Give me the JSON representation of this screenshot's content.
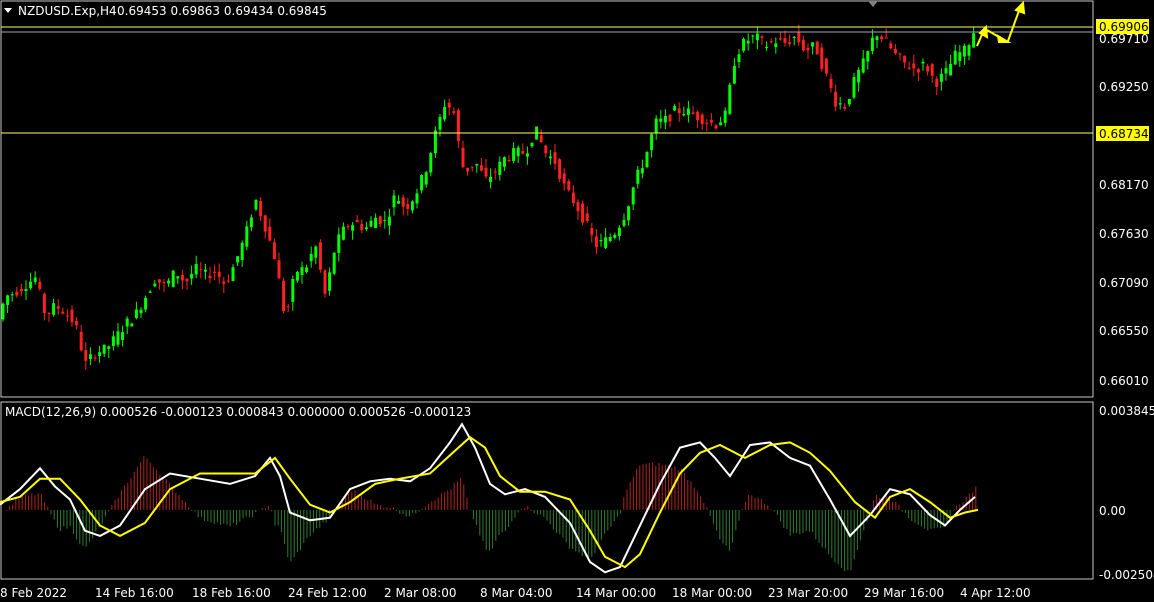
{
  "header": {
    "symbol": "NZDUSD.Exp,H4",
    "ohlc": "0.69453 0.69863 0.69434 0.69845"
  },
  "price_axis": {
    "labels": [
      "0.69250",
      "0.68170",
      "0.67630",
      "0.67090",
      "0.66550",
      "0.66010"
    ],
    "tag_upper": "0.69906",
    "tag_lower": "0.68734",
    "hidden_label": "0.69710"
  },
  "macd": {
    "title": "MACD(12,26,9) 0.000526 -0.000123 0.000843 0.000000 0.000526 -0.000123",
    "axis_labels": [
      "0.003845",
      "0.00",
      "-0.002504"
    ]
  },
  "time_axis": {
    "labels": [
      "8 Feb 2022",
      "14 Feb 16:00",
      "18 Feb 16:00",
      "24 Feb 12:00",
      "2 Mar 08:00",
      "8 Mar 04:00",
      "14 Mar 00:00",
      "18 Mar 00:00",
      "23 Mar 20:00",
      "29 Mar 16:00",
      "4 Apr 12:00"
    ]
  },
  "colors": {
    "background": "#000000",
    "bull": "#00FF00",
    "bear": "#FF2020",
    "macd_line": "#FFFFFF",
    "signal_line": "#FFFF00",
    "hist_pos": "#B22222",
    "hist_neg": "#2E7D32",
    "level_line": "#FFFF66",
    "tag_bg": "#FFFF00",
    "axis": "#C8C8C8"
  },
  "chart_data": {
    "type": "line",
    "title": "NZDUSD.Exp,H4",
    "main_axis": {
      "ylim": [
        0.658,
        0.7
      ],
      "y_ticks": [
        0.6925,
        0.6817,
        0.6763,
        0.6709,
        0.6655,
        0.6601
      ]
    },
    "levels": [
      0.69906,
      0.68734
    ],
    "price_path": [
      [
        0,
        0.665
      ],
      [
        10,
        0.6685
      ],
      [
        20,
        0.669
      ],
      [
        30,
        0.6698
      ],
      [
        40,
        0.6705
      ],
      [
        50,
        0.6665
      ],
      [
        60,
        0.6675
      ],
      [
        70,
        0.6668
      ],
      [
        80,
        0.6655
      ],
      [
        90,
        0.6612
      ],
      [
        100,
        0.6625
      ],
      [
        110,
        0.6628
      ],
      [
        120,
        0.664
      ],
      [
        130,
        0.6655
      ],
      [
        140,
        0.6665
      ],
      [
        150,
        0.6685
      ],
      [
        160,
        0.6705
      ],
      [
        170,
        0.6695
      ],
      [
        180,
        0.6712
      ],
      [
        190,
        0.67
      ],
      [
        200,
        0.6715
      ],
      [
        210,
        0.6708
      ],
      [
        220,
        0.6712
      ],
      [
        230,
        0.6698
      ],
      [
        240,
        0.6722
      ],
      [
        250,
        0.675
      ],
      [
        260,
        0.679
      ],
      [
        270,
        0.676
      ],
      [
        280,
        0.6725
      ],
      [
        290,
        0.666
      ],
      [
        300,
        0.6712
      ],
      [
        310,
        0.6715
      ],
      [
        320,
        0.674
      ],
      [
        330,
        0.6685
      ],
      [
        340,
        0.674
      ],
      [
        350,
        0.676
      ],
      [
        360,
        0.6765
      ],
      [
        370,
        0.6758
      ],
      [
        380,
        0.677
      ],
      [
        390,
        0.6765
      ],
      [
        400,
        0.6795
      ],
      [
        410,
        0.678
      ],
      [
        420,
        0.6795
      ],
      [
        430,
        0.682
      ],
      [
        440,
        0.686
      ],
      [
        450,
        0.6895
      ],
      [
        460,
        0.688
      ],
      [
        465,
        0.683
      ],
      [
        470,
        0.682
      ],
      [
        480,
        0.683
      ],
      [
        490,
        0.681
      ],
      [
        500,
        0.682
      ],
      [
        510,
        0.6835
      ],
      [
        520,
        0.684
      ],
      [
        530,
        0.684
      ],
      [
        540,
        0.6865
      ],
      [
        550,
        0.684
      ],
      [
        560,
        0.683
      ],
      [
        570,
        0.68
      ],
      [
        580,
        0.6785
      ],
      [
        590,
        0.6765
      ],
      [
        600,
        0.674
      ],
      [
        610,
        0.6745
      ],
      [
        620,
        0.6755
      ],
      [
        630,
        0.6775
      ],
      [
        640,
        0.681
      ],
      [
        650,
        0.6835
      ],
      [
        660,
        0.6872
      ],
      [
        670,
        0.6875
      ],
      [
        680,
        0.6885
      ],
      [
        690,
        0.6885
      ],
      [
        700,
        0.688
      ],
      [
        710,
        0.6875
      ],
      [
        720,
        0.687
      ],
      [
        730,
        0.688
      ],
      [
        740,
        0.6945
      ],
      [
        750,
        0.696
      ],
      [
        760,
        0.6965
      ],
      [
        770,
        0.6955
      ],
      [
        780,
        0.696
      ],
      [
        790,
        0.6958
      ],
      [
        800,
        0.6965
      ],
      [
        810,
        0.695
      ],
      [
        820,
        0.6955
      ],
      [
        830,
        0.6925
      ],
      [
        840,
        0.6895
      ],
      [
        850,
        0.689
      ],
      [
        860,
        0.692
      ],
      [
        870,
        0.694
      ],
      [
        880,
        0.697
      ],
      [
        890,
        0.696
      ],
      [
        900,
        0.6945
      ],
      [
        910,
        0.6935
      ],
      [
        920,
        0.693
      ],
      [
        930,
        0.6935
      ],
      [
        940,
        0.6915
      ],
      [
        950,
        0.6925
      ],
      [
        960,
        0.6945
      ],
      [
        970,
        0.695
      ],
      [
        980,
        0.6975
      ]
    ],
    "macd_axis": {
      "ylim": [
        -0.002504,
        0.003845
      ]
    },
    "macd_path": [
      [
        0,
        0.0002
      ],
      [
        20,
        0.0008
      ],
      [
        40,
        0.0016
      ],
      [
        55,
        0.0009
      ],
      [
        70,
        0.0004
      ],
      [
        85,
        -0.0008
      ],
      [
        100,
        -0.001
      ],
      [
        120,
        -0.0006
      ],
      [
        145,
        0.0008
      ],
      [
        170,
        0.0014
      ],
      [
        200,
        0.0012
      ],
      [
        230,
        0.001
      ],
      [
        255,
        0.0013
      ],
      [
        270,
        0.002
      ],
      [
        280,
        0.0013
      ],
      [
        290,
        -0.0001
      ],
      [
        310,
        -0.0004
      ],
      [
        330,
        -0.0003
      ],
      [
        350,
        0.0008
      ],
      [
        370,
        0.0011
      ],
      [
        390,
        0.0012
      ],
      [
        410,
        0.0011
      ],
      [
        430,
        0.0016
      ],
      [
        450,
        0.0026
      ],
      [
        462,
        0.0033
      ],
      [
        475,
        0.0024
      ],
      [
        490,
        0.001
      ],
      [
        505,
        0.0006
      ],
      [
        525,
        0.0008
      ],
      [
        545,
        0.0005
      ],
      [
        570,
        -0.0005
      ],
      [
        590,
        -0.002
      ],
      [
        605,
        -0.0024
      ],
      [
        620,
        -0.0022
      ],
      [
        640,
        -0.0006
      ],
      [
        660,
        0.001
      ],
      [
        680,
        0.0024
      ],
      [
        700,
        0.0026
      ],
      [
        715,
        0.002
      ],
      [
        730,
        0.0013
      ],
      [
        750,
        0.0025
      ],
      [
        770,
        0.0026
      ],
      [
        790,
        0.002
      ],
      [
        810,
        0.0017
      ],
      [
        830,
        0.0004
      ],
      [
        850,
        -0.001
      ],
      [
        870,
        -0.0002
      ],
      [
        890,
        0.0008
      ],
      [
        910,
        0.0006
      ],
      [
        930,
        -0.0002
      ],
      [
        945,
        -0.0006
      ],
      [
        960,
        0.0
      ],
      [
        975,
        0.0005
      ]
    ],
    "signal_path": [
      [
        0,
        0.0003
      ],
      [
        20,
        0.0005
      ],
      [
        40,
        0.0012
      ],
      [
        60,
        0.0012
      ],
      [
        80,
        0.0004
      ],
      [
        100,
        -0.0006
      ],
      [
        120,
        -0.001
      ],
      [
        145,
        -0.0005
      ],
      [
        170,
        0.0008
      ],
      [
        200,
        0.0014
      ],
      [
        230,
        0.0014
      ],
      [
        255,
        0.0014
      ],
      [
        275,
        0.002
      ],
      [
        290,
        0.0012
      ],
      [
        310,
        0.0002
      ],
      [
        330,
        -0.0001
      ],
      [
        350,
        0.0003
      ],
      [
        375,
        0.001
      ],
      [
        400,
        0.0012
      ],
      [
        430,
        0.0014
      ],
      [
        450,
        0.0021
      ],
      [
        470,
        0.0028
      ],
      [
        485,
        0.0024
      ],
      [
        500,
        0.0013
      ],
      [
        520,
        0.0007
      ],
      [
        545,
        0.0007
      ],
      [
        570,
        0.0004
      ],
      [
        590,
        -0.0008
      ],
      [
        605,
        -0.0018
      ],
      [
        625,
        -0.0022
      ],
      [
        640,
        -0.0017
      ],
      [
        660,
        -0.0001
      ],
      [
        680,
        0.0014
      ],
      [
        700,
        0.0022
      ],
      [
        720,
        0.0025
      ],
      [
        745,
        0.002
      ],
      [
        770,
        0.0025
      ],
      [
        790,
        0.0026
      ],
      [
        810,
        0.0022
      ],
      [
        830,
        0.0015
      ],
      [
        855,
        0.0003
      ],
      [
        875,
        -0.0003
      ],
      [
        890,
        0.0005
      ],
      [
        910,
        0.0008
      ],
      [
        930,
        0.0003
      ],
      [
        950,
        -0.0003
      ],
      [
        965,
        -0.0001
      ],
      [
        978,
        0.0
      ]
    ]
  }
}
